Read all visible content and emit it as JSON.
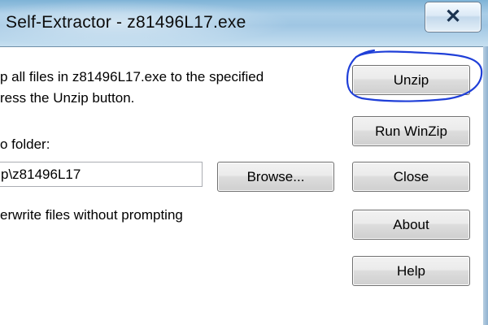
{
  "window": {
    "title": "Self-Extractor - z81496L17.exe",
    "close_glyph": "✕"
  },
  "main": {
    "message_line1": "p all files in z81496L17.exe to the specified",
    "message_line2": "ress the Unzip button.",
    "folder_label": "o folder:",
    "folder_value": "p\\z81496L17",
    "overwrite_label": "erwrite files without prompting",
    "browse_label": "Browse..."
  },
  "buttons": {
    "unzip": "Unzip",
    "run_winzip": "Run WinZip",
    "close": "Close",
    "about": "About",
    "help": "Help"
  },
  "annotation": {
    "color": "#1f3fd8",
    "target": "unzip-button"
  }
}
